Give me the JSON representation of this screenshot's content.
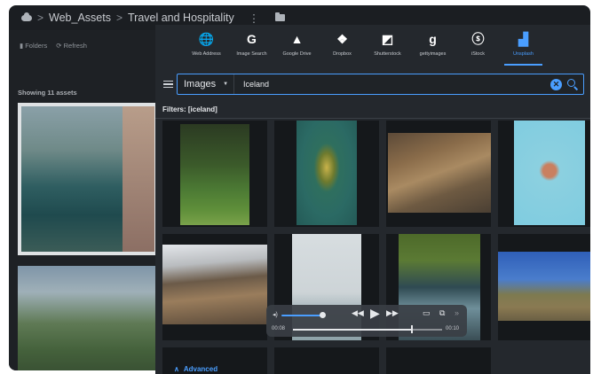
{
  "breadcrumb": {
    "root": "Web_Assets",
    "current": "Travel and Hospitality",
    "separator": ">",
    "kebab": "⋮"
  },
  "sidebar": {
    "folders_label": "Folders",
    "refresh_label": "Refresh",
    "showing_label": "Showing 11 assets"
  },
  "sources": [
    {
      "label": "Web Address",
      "glyph": "🌐",
      "icon": "globe-icon",
      "active": false
    },
    {
      "label": "Image Search",
      "glyph": "G",
      "icon": "google-icon",
      "active": false
    },
    {
      "label": "Google Drive",
      "glyph": "▲",
      "icon": "google-drive-icon",
      "active": false
    },
    {
      "label": "Dropbox",
      "glyph": "❖",
      "icon": "dropbox-icon",
      "active": false
    },
    {
      "label": "Shutterstock",
      "glyph": "◩",
      "icon": "shutterstock-icon",
      "active": false
    },
    {
      "label": "gettyimages",
      "glyph": "g",
      "icon": "gettyimages-icon",
      "active": false
    },
    {
      "label": "iStock",
      "glyph": "ⓢ",
      "icon": "istock-icon",
      "active": false
    },
    {
      "label": "Unsplash",
      "glyph": "▟",
      "icon": "unsplash-icon",
      "active": true
    }
  ],
  "search": {
    "type_value": "Images",
    "query": "Iceland",
    "clear_glyph": "✕"
  },
  "filters_label": "Filters: [iceland]",
  "player": {
    "time_current": "00:08",
    "time_total": "00:10",
    "volume_glyph": "◂)",
    "rewind_glyph": "◀◀",
    "play_glyph": "▶",
    "forward_glyph": "▶▶",
    "airplay_glyph": "▭",
    "pip_glyph": "⧉",
    "more_glyph": "»",
    "progress": 0.8
  },
  "advanced_label": "Advanced",
  "advanced_glyph": "∧",
  "colors": {
    "accent": "#4a9eff",
    "modal_bg": "#24282d",
    "frame_bg": "#1b1e22"
  }
}
